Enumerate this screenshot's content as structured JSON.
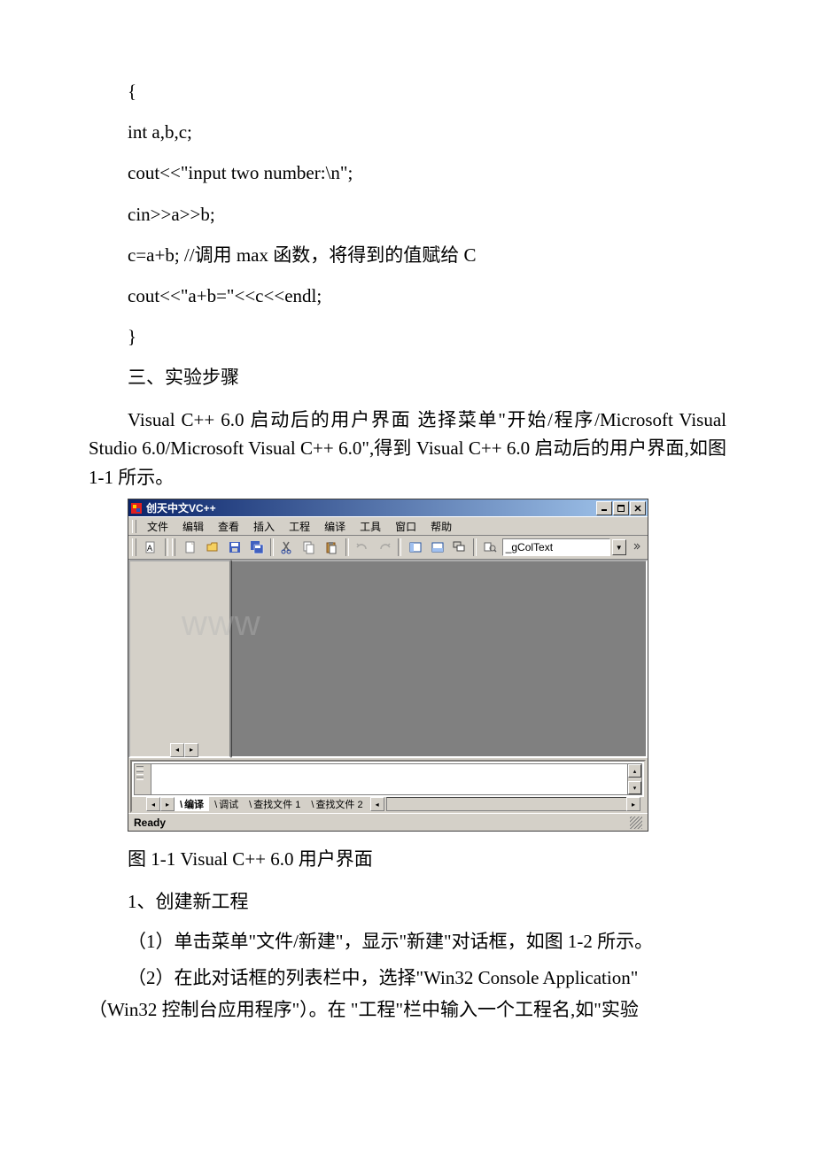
{
  "code": {
    "l1": "{",
    "l2": "int a,b,c;",
    "l3": "cout<<\"input two number:\\n\";",
    "l4": "cin>>a>>b;",
    "l5": "c=a+b; //调用 max 函数，将得到的值赋给 C",
    "l6": "cout<<\"a+b=\"<<c<<endl;",
    "l7": "}"
  },
  "sections": {
    "three_title": "三、实验步骤",
    "intro": "Visual C++ 6.0 启动后的用户界面 选择菜单\"开始/程序/Microsoft Visual Studio 6.0/Microsoft Visual C++ 6.0\",得到 Visual C++ 6.0 启动后的用户界面,如图 1-1 所示。",
    "fig_caption": "图 1-1 Visual C++ 6.0 用户界面",
    "step1_title": "1、创建新工程",
    "step1_1": "（1）单击菜单\"文件/新建\"，显示\"新建\"对话框，如图 1-2 所示。",
    "step1_2a": "（2）在此对话框的列表栏中，选择\"Win32 Console Application\"",
    "step1_2b": "（Win32 控制台应用程序\"）。在 \"工程\"栏中输入一个工程名,如\"实验"
  },
  "vc": {
    "title": "创天中文VC++",
    "menu": {
      "file": "文件",
      "edit": "编辑",
      "view": "查看",
      "insert": "插入",
      "project": "工程",
      "build": "编译",
      "tools": "工具",
      "window": "窗口",
      "help": "帮助"
    },
    "find_value": "_gColText",
    "output_tabs": {
      "compile": "编译",
      "debug": "调试",
      "find1": "查找文件 1",
      "find2": "查找文件 2"
    },
    "status": "Ready"
  },
  "watermark": "www"
}
